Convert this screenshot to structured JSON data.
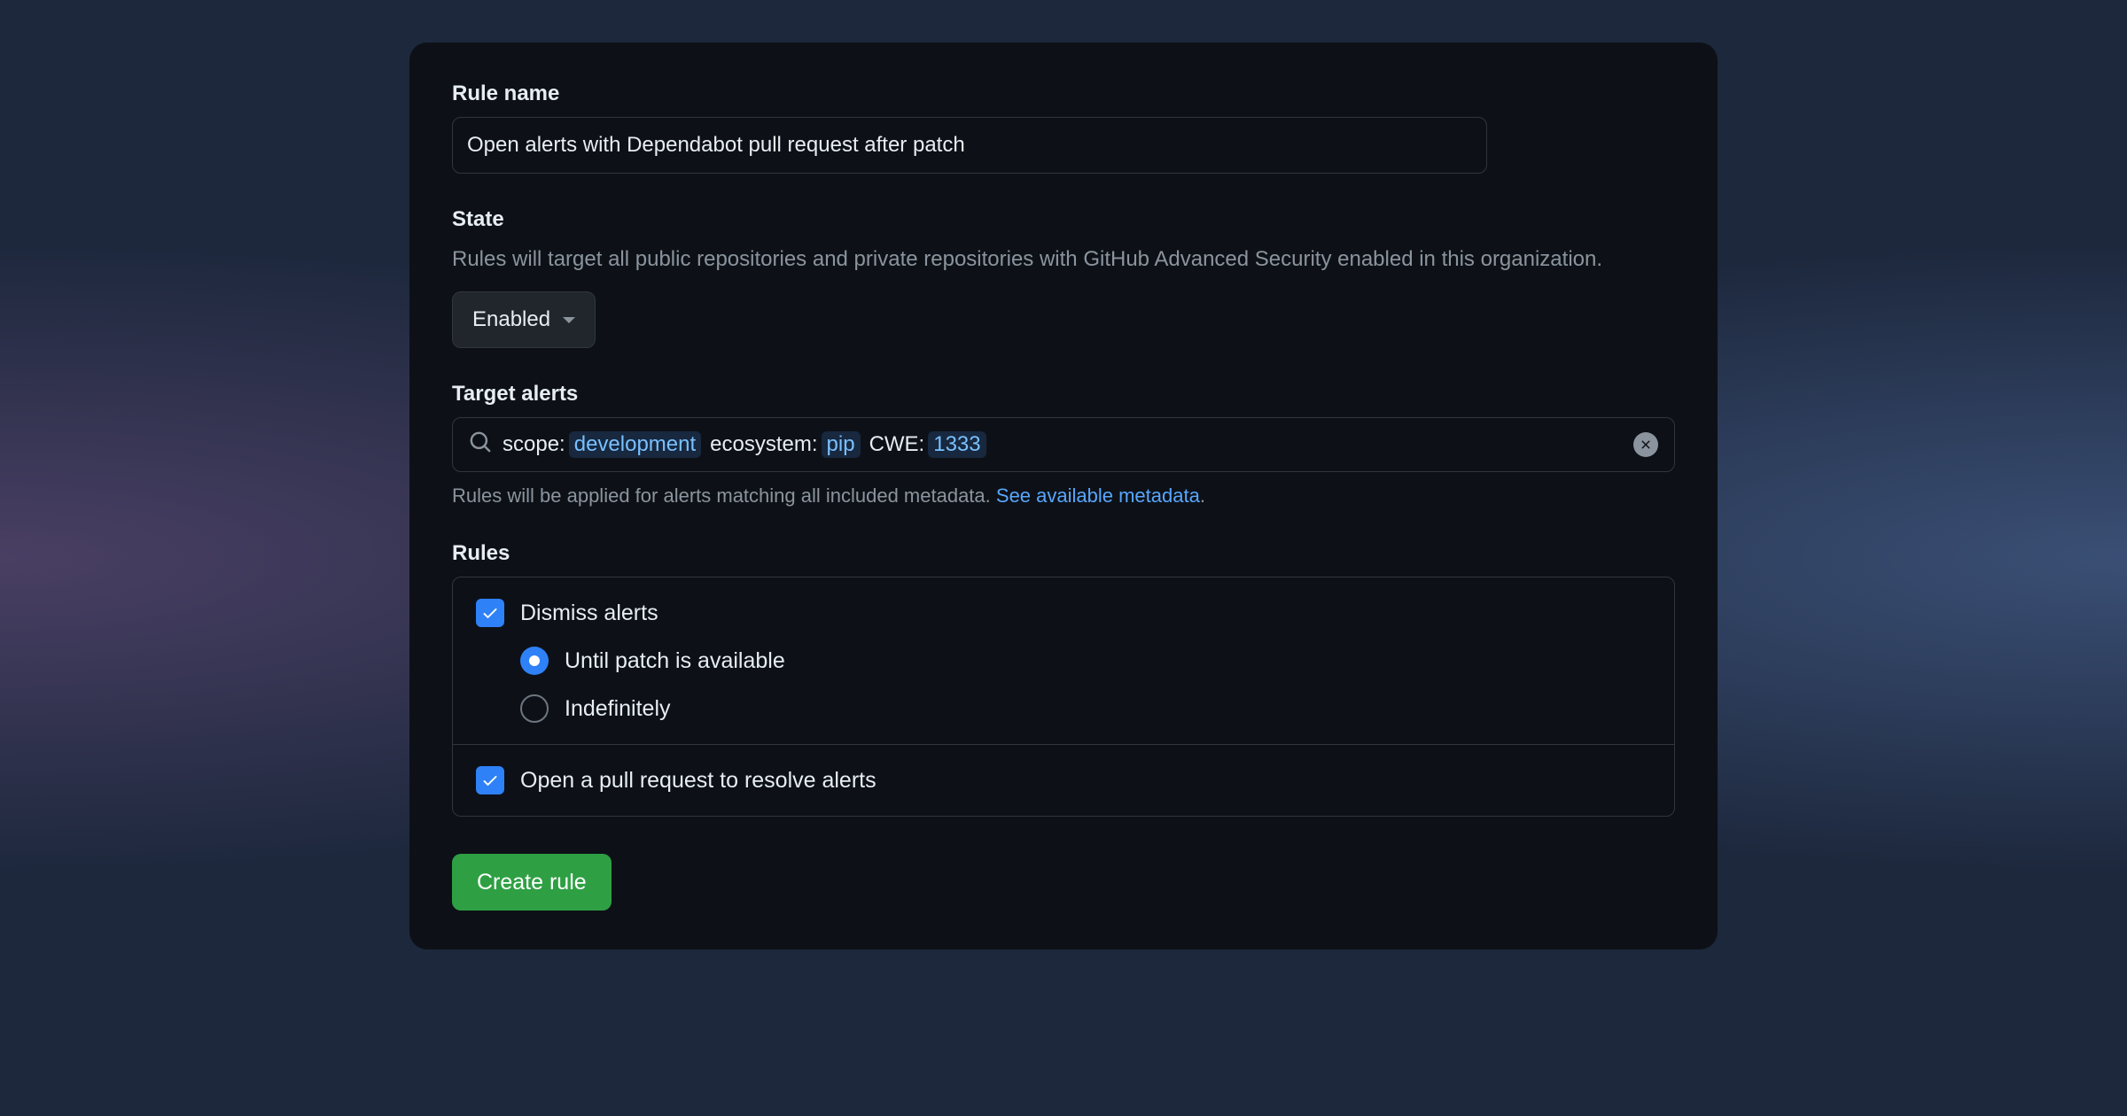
{
  "ruleName": {
    "label": "Rule name",
    "value": "Open alerts with Dependabot pull request after patch"
  },
  "state": {
    "label": "State",
    "description": "Rules will target all public repositories and private repositories with GitHub Advanced Security enabled in this organization.",
    "selected": "Enabled"
  },
  "targetAlerts": {
    "label": "Target alerts",
    "filters": [
      {
        "key": "scope:",
        "value": "development"
      },
      {
        "key": "ecosystem:",
        "value": "pip"
      },
      {
        "key": "CWE:",
        "value": "1333"
      }
    ],
    "helperText": "Rules will be applied for alerts matching all included metadata. ",
    "linkText": "See available metadata",
    "period": "."
  },
  "rules": {
    "label": "Rules",
    "dismissAlerts": {
      "label": "Dismiss alerts",
      "checked": true,
      "options": [
        {
          "label": "Until patch is available",
          "selected": true
        },
        {
          "label": "Indefinitely",
          "selected": false
        }
      ]
    },
    "openPR": {
      "label": "Open a pull request to resolve alerts",
      "checked": true
    }
  },
  "createButton": "Create rule"
}
